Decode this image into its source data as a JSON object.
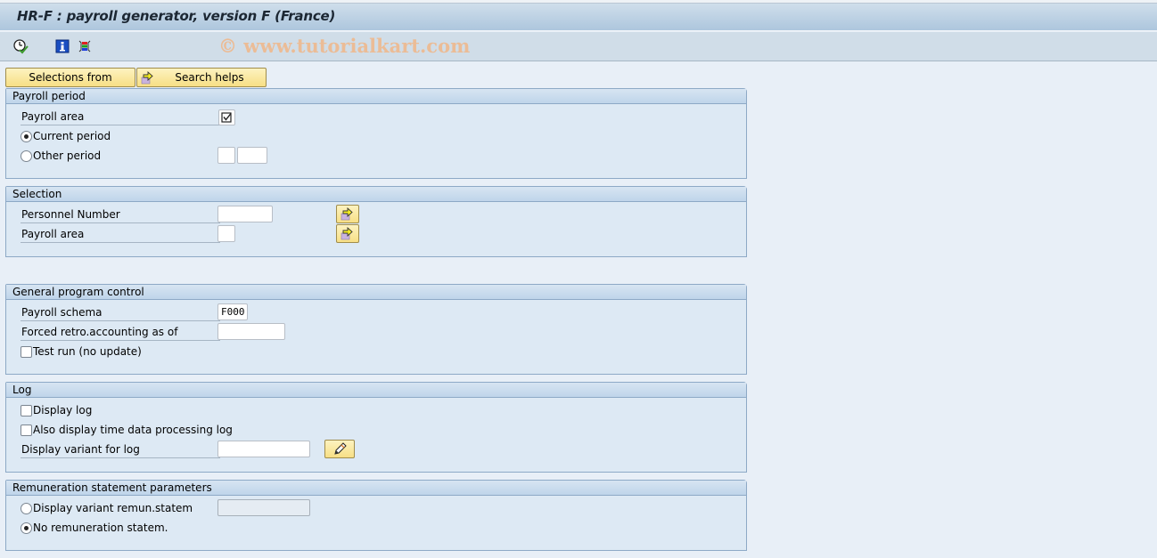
{
  "window": {
    "title": "HR-F : payroll generator, version F (France)"
  },
  "toolbar": {
    "icons": [
      {
        "name": "execute-icon",
        "tooltip": "Execute"
      },
      {
        "name": "info-icon",
        "tooltip": "Information"
      },
      {
        "name": "selection-screen-icon",
        "tooltip": "Selection options"
      }
    ],
    "watermark": "© www.tutorialkart.com"
  },
  "buttons": {
    "selections_from": "Selections from",
    "search_helps": "Search helps"
  },
  "groups": {
    "payroll_period": {
      "title": "Payroll period",
      "payroll_area_label": "Payroll area",
      "payroll_area_checked": true,
      "current_period_label": "Current period",
      "current_period_selected": true,
      "other_period_label": "Other period",
      "other_period_selected": false,
      "other_period_value_1": "",
      "other_period_value_2": ""
    },
    "selection": {
      "title": "Selection",
      "personnel_number_label": "Personnel Number",
      "personnel_number_value": "",
      "payroll_area_label": "Payroll area",
      "payroll_area_value": ""
    },
    "general_program_control": {
      "title": "General program control",
      "payroll_schema_label": "Payroll schema",
      "payroll_schema_value": "F000",
      "forced_retro_label": "Forced retro.accounting as of",
      "forced_retro_value": "",
      "test_run_label": "Test run (no update)",
      "test_run_checked": false
    },
    "log": {
      "title": "Log",
      "display_log_label": "Display log",
      "display_log_checked": false,
      "time_data_log_label": "Also display time data processing log",
      "time_data_log_checked": false,
      "display_variant_label": "Display variant for log",
      "display_variant_value": ""
    },
    "remuneration": {
      "title": "Remuneration statement parameters",
      "display_variant_label": "Display variant remun.statem",
      "display_variant_selected": false,
      "display_variant_value": "",
      "no_statement_label": "No remuneration statem.",
      "no_statement_selected": true
    }
  }
}
